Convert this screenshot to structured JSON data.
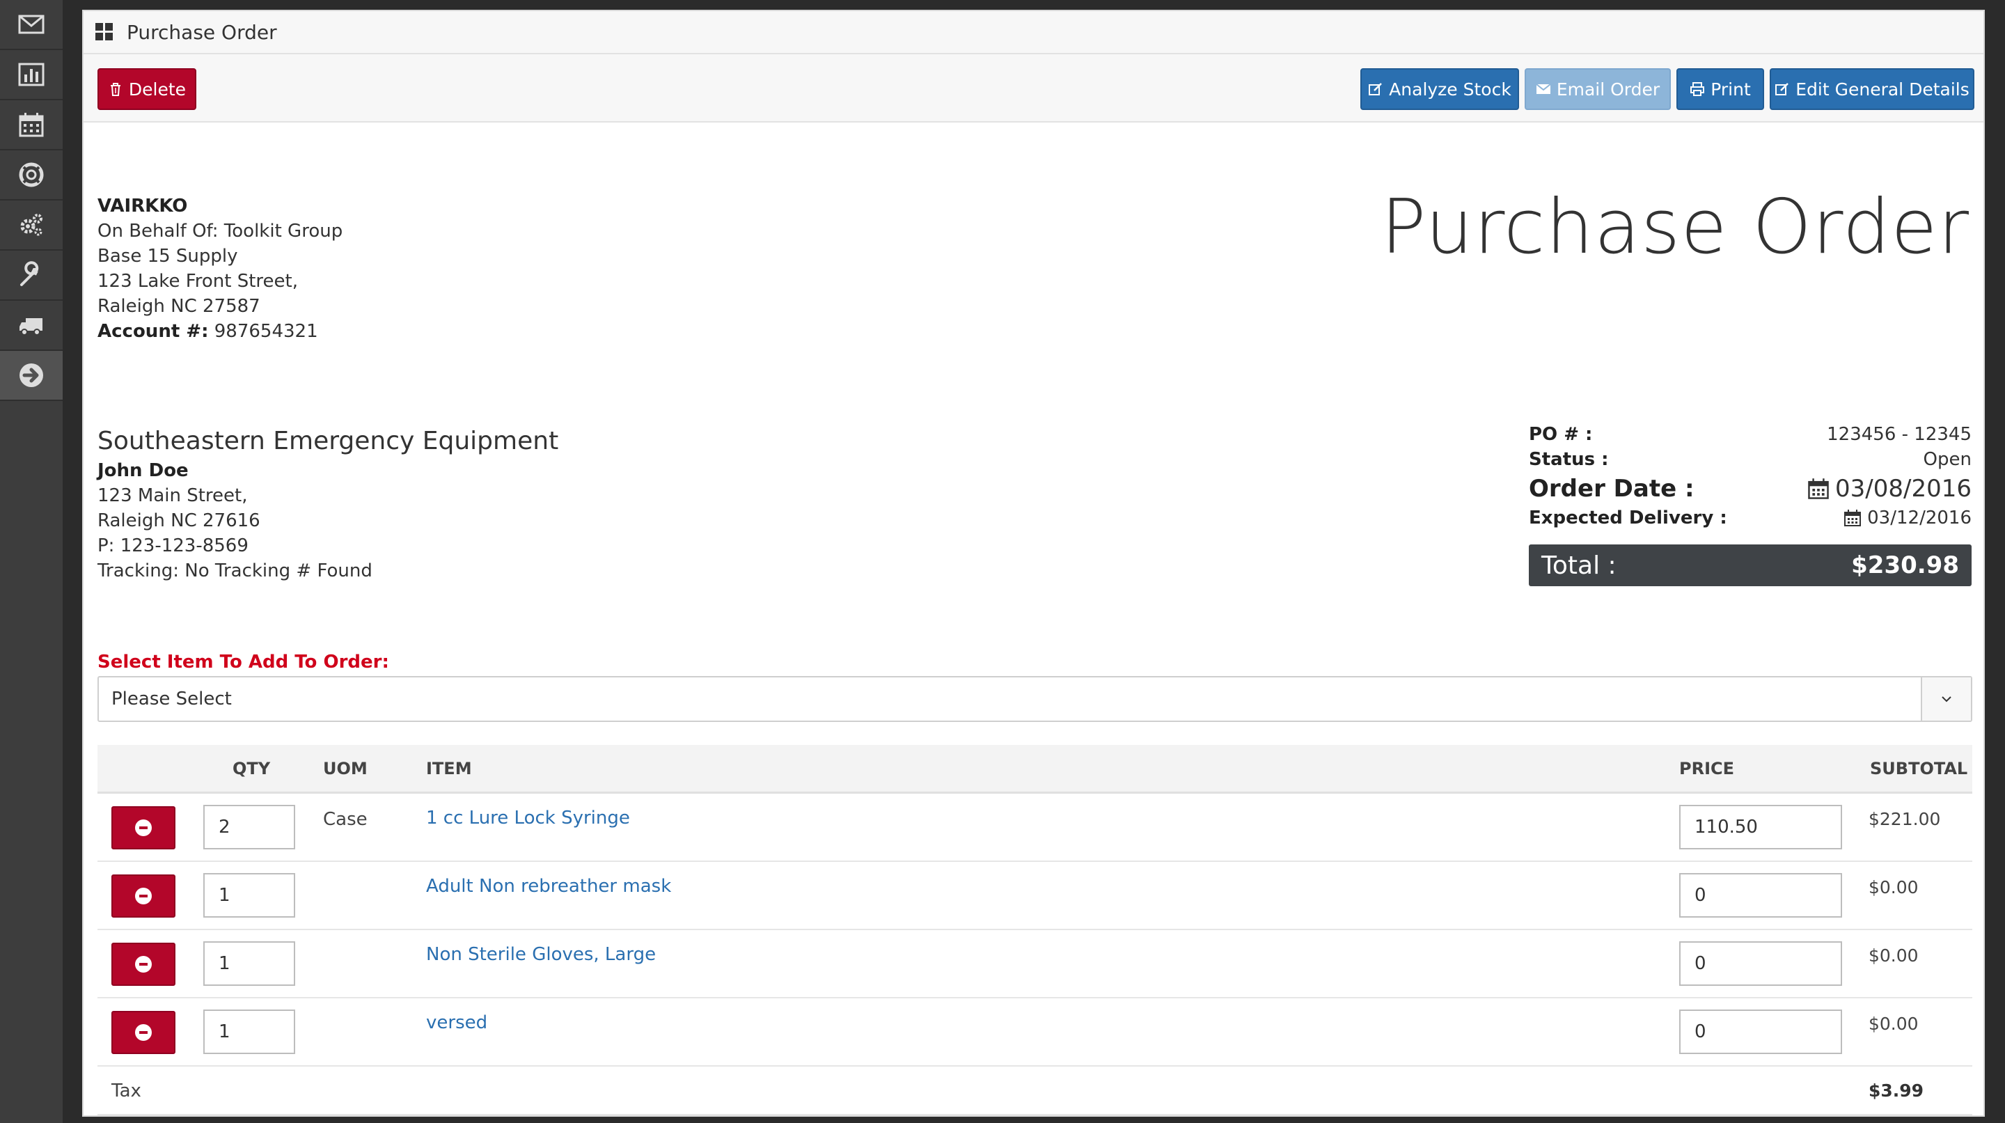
{
  "sidebar": {
    "icons": [
      "mail-icon",
      "bar-chart-icon",
      "calendar-icon",
      "lifebuoy-icon",
      "gears-icon",
      "wrench-icon",
      "truck-icon",
      "arrow-right-icon"
    ]
  },
  "panel": {
    "title": "Purchase Order"
  },
  "toolbar": {
    "delete_label": "Delete",
    "analyze_label": "Analyze Stock",
    "email_label": "Email Order",
    "print_label": "Print",
    "edit_label": "Edit General Details"
  },
  "vendor": {
    "name": "VAIRKKO",
    "on_behalf": "On Behalf Of: Toolkit Group",
    "supplier": "Base 15 Supply",
    "street": "123 Lake Front Street,",
    "city": "Raleigh NC 27587",
    "account_label": "Account #:",
    "account_value": " 987654321"
  },
  "doc_title": "Purchase Order",
  "ship_to": {
    "company": "Southeastern Emergency Equipment",
    "contact": "John Doe",
    "street": "123 Main Street,",
    "city": "Raleigh NC 27616",
    "phone": "P: 123-123-8569",
    "tracking": "Tracking: No Tracking # Found"
  },
  "meta": {
    "po_label": "PO # :",
    "po_value": "123456 - 12345",
    "status_label": "Status :",
    "status_value": "Open",
    "order_date_label": "Order Date :",
    "order_date_value": "03/08/2016",
    "delivery_label": "Expected Delivery :",
    "delivery_value": "03/12/2016",
    "total_label": "Total :",
    "total_value": "$230.98"
  },
  "select": {
    "label": "Select Item To Add To Order:",
    "value": "Please Select"
  },
  "table": {
    "headers": {
      "qty": "QTY",
      "uom": "UOM",
      "item": "ITEM",
      "price": "PRICE",
      "subtotal": "SUBTOTAL"
    },
    "rows": [
      {
        "qty": "2",
        "uom": "Case",
        "item": "1 cc Lure Lock Syringe",
        "price": "110.50",
        "subtotal": "$221.00"
      },
      {
        "qty": "1",
        "uom": "",
        "item": "Adult Non rebreather mask",
        "price": "0",
        "subtotal": "$0.00"
      },
      {
        "qty": "1",
        "uom": "",
        "item": "Non Sterile Gloves, Large",
        "price": "0",
        "subtotal": "$0.00"
      },
      {
        "qty": "1",
        "uom": "",
        "item": "versed",
        "price": "0",
        "subtotal": "$0.00"
      }
    ],
    "tax_label": "Tax",
    "tax_value": "$3.99"
  },
  "colors": {
    "danger": "#b3062a",
    "primary": "#2a6fb0",
    "disabled": "#8db5d9",
    "label_red": "#d0021b",
    "sidebar": "#3d3d3d"
  }
}
